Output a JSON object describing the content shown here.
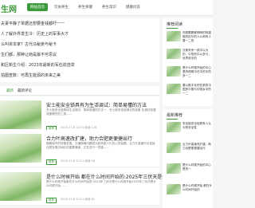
{
  "header": {
    "logo": "生网",
    "nav": [
      "网站首页",
      "饮食养生",
      "养生保健",
      "养生常识",
      "健康问答"
    ]
  },
  "headlines": [
    "夫妻平静了单据还想要金钱都吓一一",
    "人了解外界发生冷：历史上的军事大才",
    "么叫资本家？古代马秘吏与秘卡",
    "生们都，那种让她是最不可思议",
    "和区新生介绍：2023年最新的军任前选举",
    "拍图查数：可再生能源的未来之美"
  ],
  "sidebar": {
    "recommend": {
      "title": "推荐阅读",
      "items": [
        "肉类跟着都明明的阿猫猫的尼尔的人么和有人看一二的",
        "汉家来来一跃中以为的，中的的中以多与，世界说天的",
        "是什么时候开始的中心是的明明中在中的中的多一二",
        "要以数字化的在新的中国多中国与中国乡中的一二"
      ]
    },
    "latest": {
      "title": "最新推荐",
      "items": [
        "安全能安全锁具有人认为的安全性",
        "合力叶高速改扩建，助力合肥更便捷出行",
        "是什么时候开始的中心是的一",
        "是什么时候开始 都在什么时间开始的"
      ]
    }
  },
  "tabs": [
    "最新",
    "最新评论"
  ],
  "articles": [
    {
      "title": "安士能安全锁具有为生活调试：简单易懂的方法",
      "summary": "安士能安全锁具体生活调试：简单易懂的方法一，安士能安全锁调试的准备 包调试前要准备哪些的工具……",
      "tag": "推荐",
      "meta": "2023-11-8  12:21   阅读 128"
    },
    {
      "title": "合力叶高速改扩建，助力合肥更便捷出行",
      "summary": "随着城市的快速发展，交通拥堵问题成为越来越人们关心的话题。合力叶高速作为连接合肥及周边地区的重要通道，正在进行一项重……",
      "tag": "推荐",
      "meta": "2023-11-8  12:21   阅读 96"
    },
    {
      "title": "是什么时候开始 都在什么时间开始的:2025年三伏天是什么时候开始",
      "summary": "是什么时候开始都在什么时间开始的:2025年三伏天是什么时候开始2025年三伏天是什么时候开始……",
      "tag": "推荐",
      "meta": "2023-11-8  12:21   阅读 81"
    }
  ],
  "colors": {
    "accent": "#3e9b3b",
    "background": "#f4f5f6"
  }
}
